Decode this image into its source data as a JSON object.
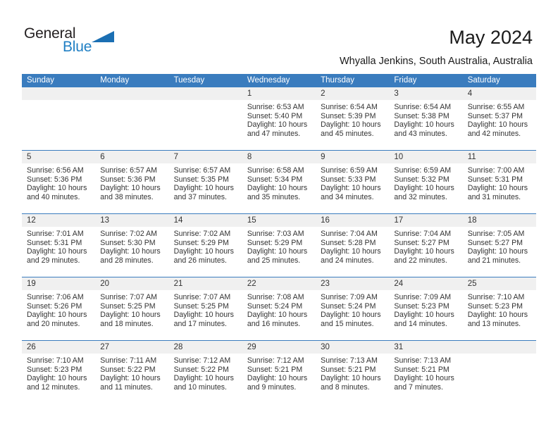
{
  "brand": {
    "name_part1": "General",
    "name_part2": "Blue"
  },
  "header": {
    "title": "May 2024",
    "subtitle": "Whyalla Jenkins, South Australia, Australia"
  },
  "colors": {
    "header_blue": "#3a7cbe",
    "band_gray": "#f0f0f0",
    "text": "#333333",
    "brand_blue": "#1f7fc4"
  },
  "weekdays": [
    "Sunday",
    "Monday",
    "Tuesday",
    "Wednesday",
    "Thursday",
    "Friday",
    "Saturday"
  ],
  "weeks": [
    {
      "days": [
        {
          "num": "",
          "sunrise": "",
          "sunset": "",
          "daylight": ""
        },
        {
          "num": "",
          "sunrise": "",
          "sunset": "",
          "daylight": ""
        },
        {
          "num": "",
          "sunrise": "",
          "sunset": "",
          "daylight": ""
        },
        {
          "num": "1",
          "sunrise": "Sunrise: 6:53 AM",
          "sunset": "Sunset: 5:40 PM",
          "daylight": "Daylight: 10 hours and 47 minutes."
        },
        {
          "num": "2",
          "sunrise": "Sunrise: 6:54 AM",
          "sunset": "Sunset: 5:39 PM",
          "daylight": "Daylight: 10 hours and 45 minutes."
        },
        {
          "num": "3",
          "sunrise": "Sunrise: 6:54 AM",
          "sunset": "Sunset: 5:38 PM",
          "daylight": "Daylight: 10 hours and 43 minutes."
        },
        {
          "num": "4",
          "sunrise": "Sunrise: 6:55 AM",
          "sunset": "Sunset: 5:37 PM",
          "daylight": "Daylight: 10 hours and 42 minutes."
        }
      ]
    },
    {
      "days": [
        {
          "num": "5",
          "sunrise": "Sunrise: 6:56 AM",
          "sunset": "Sunset: 5:36 PM",
          "daylight": "Daylight: 10 hours and 40 minutes."
        },
        {
          "num": "6",
          "sunrise": "Sunrise: 6:57 AM",
          "sunset": "Sunset: 5:36 PM",
          "daylight": "Daylight: 10 hours and 38 minutes."
        },
        {
          "num": "7",
          "sunrise": "Sunrise: 6:57 AM",
          "sunset": "Sunset: 5:35 PM",
          "daylight": "Daylight: 10 hours and 37 minutes."
        },
        {
          "num": "8",
          "sunrise": "Sunrise: 6:58 AM",
          "sunset": "Sunset: 5:34 PM",
          "daylight": "Daylight: 10 hours and 35 minutes."
        },
        {
          "num": "9",
          "sunrise": "Sunrise: 6:59 AM",
          "sunset": "Sunset: 5:33 PM",
          "daylight": "Daylight: 10 hours and 34 minutes."
        },
        {
          "num": "10",
          "sunrise": "Sunrise: 6:59 AM",
          "sunset": "Sunset: 5:32 PM",
          "daylight": "Daylight: 10 hours and 32 minutes."
        },
        {
          "num": "11",
          "sunrise": "Sunrise: 7:00 AM",
          "sunset": "Sunset: 5:31 PM",
          "daylight": "Daylight: 10 hours and 31 minutes."
        }
      ]
    },
    {
      "days": [
        {
          "num": "12",
          "sunrise": "Sunrise: 7:01 AM",
          "sunset": "Sunset: 5:31 PM",
          "daylight": "Daylight: 10 hours and 29 minutes."
        },
        {
          "num": "13",
          "sunrise": "Sunrise: 7:02 AM",
          "sunset": "Sunset: 5:30 PM",
          "daylight": "Daylight: 10 hours and 28 minutes."
        },
        {
          "num": "14",
          "sunrise": "Sunrise: 7:02 AM",
          "sunset": "Sunset: 5:29 PM",
          "daylight": "Daylight: 10 hours and 26 minutes."
        },
        {
          "num": "15",
          "sunrise": "Sunrise: 7:03 AM",
          "sunset": "Sunset: 5:29 PM",
          "daylight": "Daylight: 10 hours and 25 minutes."
        },
        {
          "num": "16",
          "sunrise": "Sunrise: 7:04 AM",
          "sunset": "Sunset: 5:28 PM",
          "daylight": "Daylight: 10 hours and 24 minutes."
        },
        {
          "num": "17",
          "sunrise": "Sunrise: 7:04 AM",
          "sunset": "Sunset: 5:27 PM",
          "daylight": "Daylight: 10 hours and 22 minutes."
        },
        {
          "num": "18",
          "sunrise": "Sunrise: 7:05 AM",
          "sunset": "Sunset: 5:27 PM",
          "daylight": "Daylight: 10 hours and 21 minutes."
        }
      ]
    },
    {
      "days": [
        {
          "num": "19",
          "sunrise": "Sunrise: 7:06 AM",
          "sunset": "Sunset: 5:26 PM",
          "daylight": "Daylight: 10 hours and 20 minutes."
        },
        {
          "num": "20",
          "sunrise": "Sunrise: 7:07 AM",
          "sunset": "Sunset: 5:25 PM",
          "daylight": "Daylight: 10 hours and 18 minutes."
        },
        {
          "num": "21",
          "sunrise": "Sunrise: 7:07 AM",
          "sunset": "Sunset: 5:25 PM",
          "daylight": "Daylight: 10 hours and 17 minutes."
        },
        {
          "num": "22",
          "sunrise": "Sunrise: 7:08 AM",
          "sunset": "Sunset: 5:24 PM",
          "daylight": "Daylight: 10 hours and 16 minutes."
        },
        {
          "num": "23",
          "sunrise": "Sunrise: 7:09 AM",
          "sunset": "Sunset: 5:24 PM",
          "daylight": "Daylight: 10 hours and 15 minutes."
        },
        {
          "num": "24",
          "sunrise": "Sunrise: 7:09 AM",
          "sunset": "Sunset: 5:23 PM",
          "daylight": "Daylight: 10 hours and 14 minutes."
        },
        {
          "num": "25",
          "sunrise": "Sunrise: 7:10 AM",
          "sunset": "Sunset: 5:23 PM",
          "daylight": "Daylight: 10 hours and 13 minutes."
        }
      ]
    },
    {
      "days": [
        {
          "num": "26",
          "sunrise": "Sunrise: 7:10 AM",
          "sunset": "Sunset: 5:23 PM",
          "daylight": "Daylight: 10 hours and 12 minutes."
        },
        {
          "num": "27",
          "sunrise": "Sunrise: 7:11 AM",
          "sunset": "Sunset: 5:22 PM",
          "daylight": "Daylight: 10 hours and 11 minutes."
        },
        {
          "num": "28",
          "sunrise": "Sunrise: 7:12 AM",
          "sunset": "Sunset: 5:22 PM",
          "daylight": "Daylight: 10 hours and 10 minutes."
        },
        {
          "num": "29",
          "sunrise": "Sunrise: 7:12 AM",
          "sunset": "Sunset: 5:21 PM",
          "daylight": "Daylight: 10 hours and 9 minutes."
        },
        {
          "num": "30",
          "sunrise": "Sunrise: 7:13 AM",
          "sunset": "Sunset: 5:21 PM",
          "daylight": "Daylight: 10 hours and 8 minutes."
        },
        {
          "num": "31",
          "sunrise": "Sunrise: 7:13 AM",
          "sunset": "Sunset: 5:21 PM",
          "daylight": "Daylight: 10 hours and 7 minutes."
        },
        {
          "num": "",
          "sunrise": "",
          "sunset": "",
          "daylight": ""
        }
      ]
    }
  ]
}
